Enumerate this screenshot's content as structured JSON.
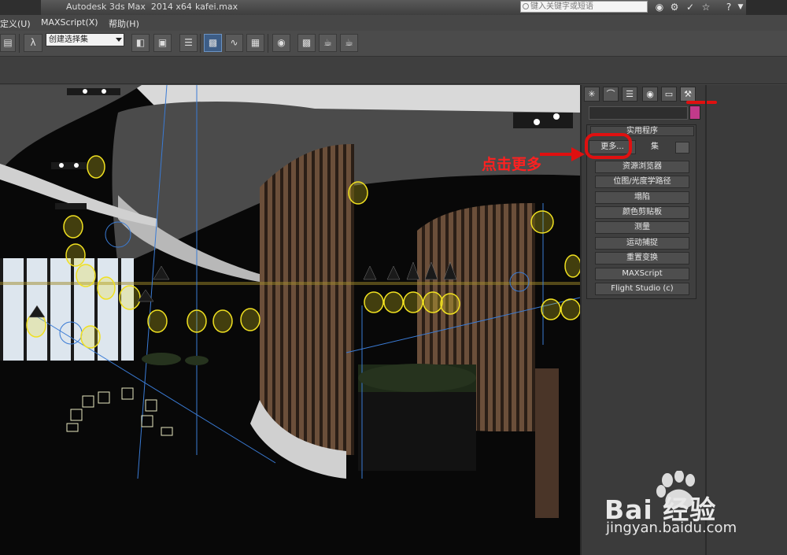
{
  "titlebar": {
    "title": "Autodesk 3ds Max  2014 x64",
    "file": "kafei.max",
    "search_placeholder": "键入关键字或短语"
  },
  "menubar": {
    "items": [
      "定义(U)",
      "MAXScript(X)",
      "帮助(H)"
    ]
  },
  "toolbar": {
    "selection_set": "创建选择集"
  },
  "command_panel": {
    "rollout_title": "实用程序",
    "more_button": "更多...",
    "sets_button": "集",
    "utilities": [
      "资源浏览器",
      "位图/光度学路径",
      "塌陷",
      "颜色剪贴板",
      "测量",
      "运动捕捉",
      "重置变换",
      "MAXScript",
      "Flight Studio (c)"
    ]
  },
  "annotation": {
    "text": "点击更多",
    "color": "#ff2020"
  },
  "watermark": {
    "brand": "Bai 经验",
    "url": "jingyan.baidu.com"
  },
  "colors": {
    "highlight_red": "#e01010",
    "active_blue": "#3d5d86",
    "object_color": "#c23a8a"
  }
}
